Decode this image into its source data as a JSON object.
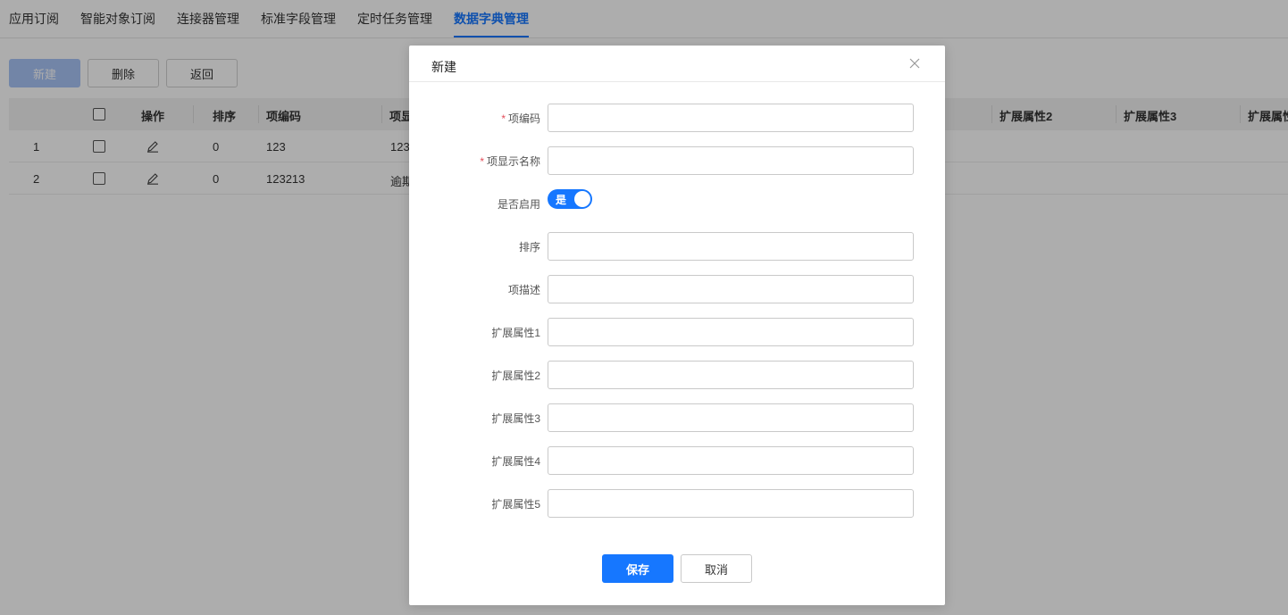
{
  "tabs": [
    "应用订阅",
    "智能对象订阅",
    "连接器管理",
    "标准字段管理",
    "定时任务管理",
    "数据字典管理"
  ],
  "active_tab": "数据字典管理",
  "toolbar": {
    "new_label": "新建",
    "delete_label": "删除",
    "back_label": "返回"
  },
  "table": {
    "columns": [
      "操作",
      "排序",
      "项编码",
      "项显",
      "扩展属性2",
      "扩展属性3",
      "扩展属性"
    ],
    "rows": [
      {
        "index": "1",
        "sort": "0",
        "code": "123",
        "display": "123"
      },
      {
        "index": "2",
        "sort": "0",
        "code": "123213",
        "display": "逾期"
      }
    ]
  },
  "modal": {
    "title": "新建",
    "fields": {
      "code": {
        "label": "项编码",
        "required": "*",
        "value": ""
      },
      "display_name": {
        "label": "项显示名称",
        "required": "*",
        "value": ""
      },
      "enabled": {
        "label": "是否启用",
        "switch_text": "是",
        "on": true
      },
      "sort": {
        "label": "排序",
        "value": ""
      },
      "description": {
        "label": "项描述",
        "value": ""
      },
      "ext1": {
        "label": "扩展属性1",
        "value": ""
      },
      "ext2": {
        "label": "扩展属性2",
        "value": ""
      },
      "ext3": {
        "label": "扩展属性3",
        "value": ""
      },
      "ext4": {
        "label": "扩展属性4",
        "value": ""
      },
      "ext5": {
        "label": "扩展属性5",
        "value": ""
      }
    },
    "save_label": "保存",
    "cancel_label": "取消"
  },
  "colors": {
    "primary": "#1677ff",
    "required": "#e34d59",
    "overlay": "rgba(0,0,0,0.32)"
  }
}
